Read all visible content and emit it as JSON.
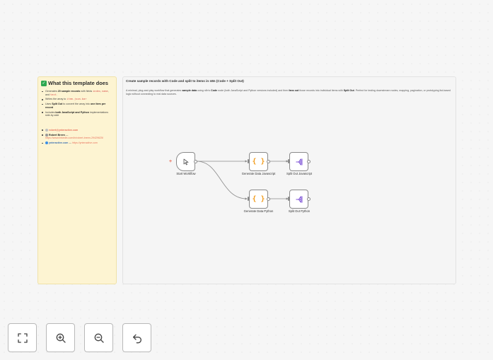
{
  "sticky_left": {
    "title": "What this template does",
    "title_icon": "check-mark-icon",
    "bullets": [
      {
        "pre": "Generates ",
        "bold": "20 sample records",
        "mid": " with fields ",
        "code1": "index",
        "sep1": ", ",
        "code2": "name",
        "sep2": ", and ",
        "code3": "text",
        "post": "."
      },
      {
        "pre": "Writes the array to ",
        "code": "item.json.bar",
        "post": ""
      },
      {
        "pre": "Uses ",
        "bold1": "Split Out",
        "mid": " to convert the array into ",
        "bold2": "one item per record",
        "post": ""
      },
      {
        "pre": "Includes ",
        "bold": "both JavaScript and Python",
        "post": " implementations side-by-side"
      }
    ],
    "contacts": {
      "email": "robert@ynteractive.com",
      "name_label": "Robert Breen",
      "name_sep": " — ",
      "linkedin": "https://www.linkedin.com/in/robert-breen-29429625/",
      "site_label": "ynteractive.com",
      "site_sep": " — ",
      "site_url": "https://ynteractive.com"
    }
  },
  "sticky_main": {
    "title": "Create sample records with Code and split to items in n8n (Code + Split Out)",
    "desc_parts": {
      "p1": "A minimal, plug-and-play workflow that generates ",
      "b1": "sample data",
      "p2": " using n8n's ",
      "b2": "Code",
      "p3": " node (both JavaScript and Python versions included) and then ",
      "b3": "fans out",
      "p4": " those records into individual items with ",
      "b4": "Split Out",
      "p5": ". Perfect for testing downstream nodes, mapping, pagination, or prototyping list-based logic without connecting to real data sources."
    }
  },
  "nodes": {
    "start": {
      "label": "Start Workflow",
      "icon": "cursor-click-icon"
    },
    "gen_js": {
      "label": "Generate Data Javascript",
      "icon": "code-braces-icon"
    },
    "split_js": {
      "label": "Split Out Javascript",
      "icon": "split-out-icon"
    },
    "gen_py": {
      "label": "Generate Data Python",
      "icon": "code-braces-icon"
    },
    "split_py": {
      "label": "Split Out Python",
      "icon": "split-out-icon"
    }
  },
  "braces_glyph": "{ }",
  "trigger_marker": "+",
  "controls": [
    {
      "name": "fit-view-button",
      "icon": "fit-to-screen-icon"
    },
    {
      "name": "zoom-in-button",
      "icon": "zoom-in-icon"
    },
    {
      "name": "zoom-out-button",
      "icon": "zoom-out-icon"
    },
    {
      "name": "undo-button",
      "icon": "undo-icon"
    }
  ],
  "colors": {
    "accent": "#e8715c",
    "code_orange": "#f29d1f",
    "split_purple": "#7b4fd6",
    "sticky_yellow": "#fdf4d2",
    "check_green": "#2fa84f"
  }
}
